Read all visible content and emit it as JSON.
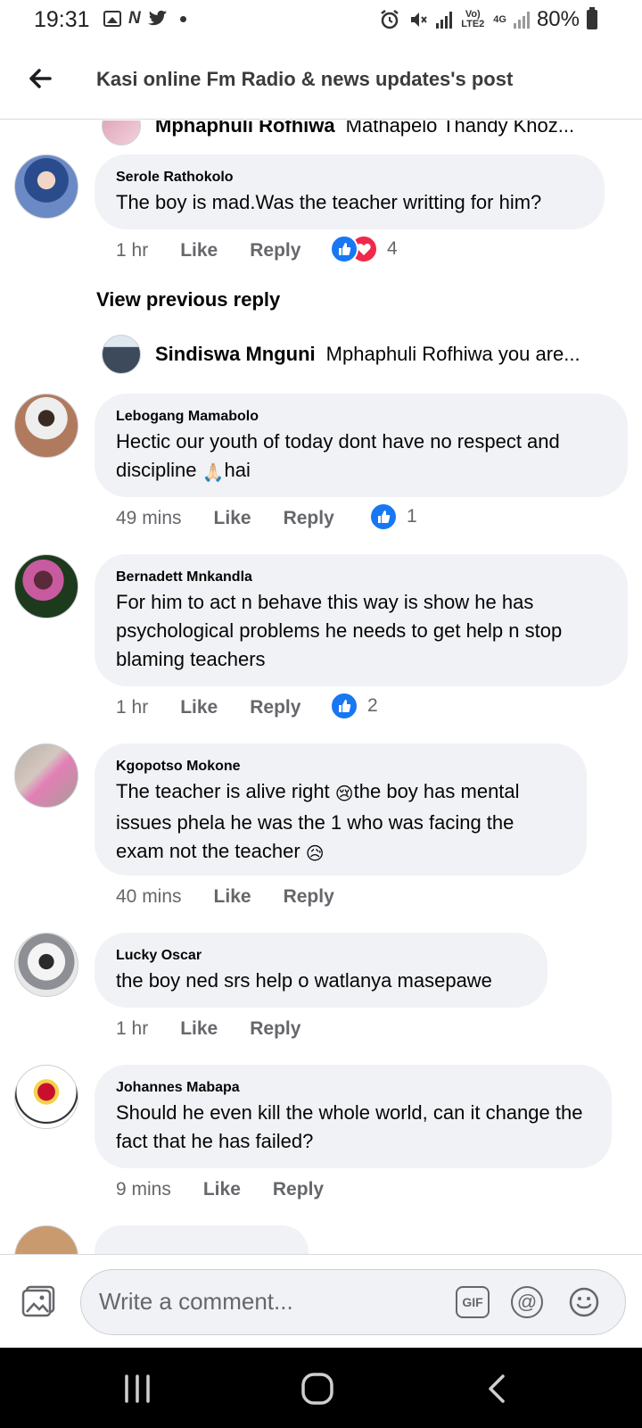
{
  "status_bar": {
    "time": "19:31",
    "network_label": "Vo) LTE2",
    "net_type": "4G",
    "battery": "80%"
  },
  "header": {
    "title": "Kasi online Fm Radio & news updates's post"
  },
  "top_reply": {
    "name": "Mphaphuli Rofhiwa",
    "text": "Mathapelo Thandy Khoz..."
  },
  "comments": [
    {
      "author": "Serole Rathokolo",
      "text": "The boy is mad.Was the teacher writting for him?",
      "time": "1 hr",
      "like": "Like",
      "reply": "Reply",
      "reaction_count": "4",
      "reactions": [
        "like",
        "love"
      ]
    },
    {
      "author": "Lebogang Mamabolo",
      "text_before_emoji": "Hectic our youth of today dont have no respect and discipline ",
      "emoji": "🙏🏻",
      "text_after_emoji": "hai",
      "time": "49 mins",
      "like": "Like",
      "reply": "Reply",
      "reaction_count": "1",
      "reactions": [
        "like"
      ]
    },
    {
      "author": "Bernadett Mnkandla",
      "text": "For him to act n behave this way is show he has psychological problems he needs to get help n stop blaming teachers",
      "time": "1 hr",
      "like": "Like",
      "reply": "Reply",
      "reaction_count": "2",
      "reactions": [
        "like"
      ]
    },
    {
      "author": "Kgopotso Mokone",
      "text_part1": "The teacher is alive right ",
      "emoji1": "😢",
      "text_part2": "the boy has mental issues phela he was the 1 who was facing the exam not the teacher ",
      "emoji2": "😥",
      "time": "40 mins",
      "like": "Like",
      "reply": "Reply"
    },
    {
      "author": "Lucky Oscar",
      "text": "the boy ned srs help o watlanya masepawe",
      "time": "1 hr",
      "like": "Like",
      "reply": "Reply"
    },
    {
      "author": "Johannes Mabapa",
      "text": "Should he even kill the whole world, can it change the fact that he has failed?",
      "time": "9 mins",
      "like": "Like",
      "reply": "Reply"
    }
  ],
  "view_previous": "View previous reply",
  "nested_reply": {
    "name": "Sindiswa Mnguni",
    "text": "Mphaphuli Rofhiwa you are..."
  },
  "composer": {
    "placeholder": "Write a comment...",
    "gif_label": "GIF",
    "mention_symbol": "@"
  },
  "colors": {
    "facebook_blue": "#1877f2",
    "love_red": "#f02849",
    "bubble_gray": "#f0f2f5",
    "meta_gray": "#65676b"
  },
  "icons": {
    "back": "arrow-left-icon",
    "photo": "photo-icon",
    "emoji": "smiley-icon",
    "nav_recents": "recent-apps-icon",
    "nav_home": "home-icon",
    "nav_back": "chevron-left-icon"
  }
}
